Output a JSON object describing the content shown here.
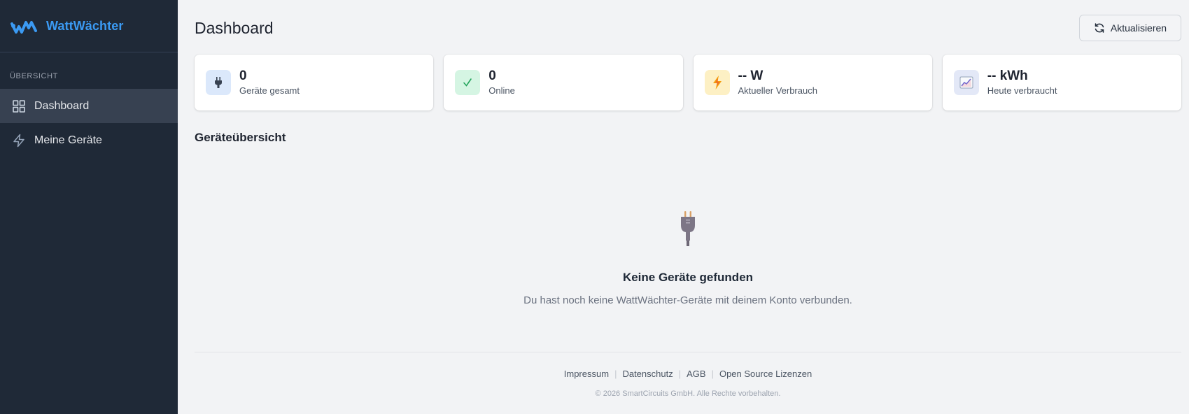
{
  "brand": {
    "name": "WattWächter",
    "color": "#3b9af3"
  },
  "sidebar": {
    "section_label": "ÜBERSICHT",
    "items": [
      {
        "label": "Dashboard",
        "icon": "grid-icon",
        "active": true
      },
      {
        "label": "Meine Geräte",
        "icon": "bolt-outline-icon",
        "active": false
      }
    ]
  },
  "header": {
    "title": "Dashboard",
    "refresh_label": "Aktualisieren"
  },
  "stats": [
    {
      "value": "0",
      "label": "Geräte gesamt",
      "icon": "plug-icon",
      "icon_bg": "#dbe8fb"
    },
    {
      "value": "0",
      "label": "Online",
      "icon": "check-icon",
      "icon_bg": "#d5f5e3"
    },
    {
      "value": "-- W",
      "label": "Aktueller Verbrauch",
      "icon": "lightning-icon",
      "icon_bg": "#fdf0c4"
    },
    {
      "value": "-- kWh",
      "label": "Heute verbraucht",
      "icon": "chart-icon",
      "icon_bg": "#e3e8f7"
    }
  ],
  "devices": {
    "title": "Geräteübersicht",
    "empty_title": "Keine Geräte gefunden",
    "empty_desc": "Du hast noch keine WattWächter-Geräte mit deinem Konto verbunden."
  },
  "footer": {
    "links": [
      "Impressum",
      "Datenschutz",
      "AGB",
      "Open Source Lizenzen"
    ],
    "copyright": "© 2026 SmartCircuits GmbH. Alle Rechte vorbehalten."
  }
}
